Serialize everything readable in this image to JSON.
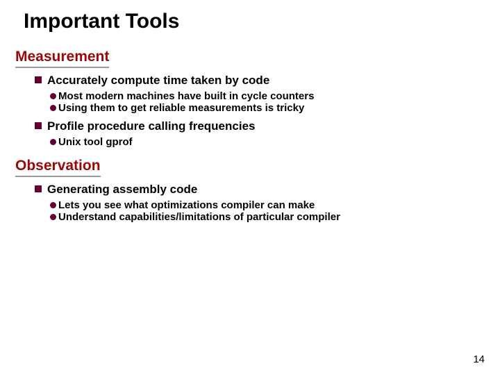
{
  "title": "Important Tools",
  "sections": [
    {
      "heading": "Measurement",
      "items": [
        {
          "text": "Accurately compute time taken by code",
          "subs": [
            "Most modern machines have built in cycle counters",
            "Using them to get reliable measurements is tricky"
          ]
        },
        {
          "text": "Profile procedure calling frequencies",
          "subs": [
            "Unix tool gprof"
          ]
        }
      ]
    },
    {
      "heading": "Observation",
      "items": [
        {
          "text": "Generating assembly code",
          "subs": [
            "Lets you see what optimizations compiler can make",
            "Understand capabilities/limitations of particular compiler"
          ]
        }
      ]
    }
  ],
  "pageNumber": "14"
}
